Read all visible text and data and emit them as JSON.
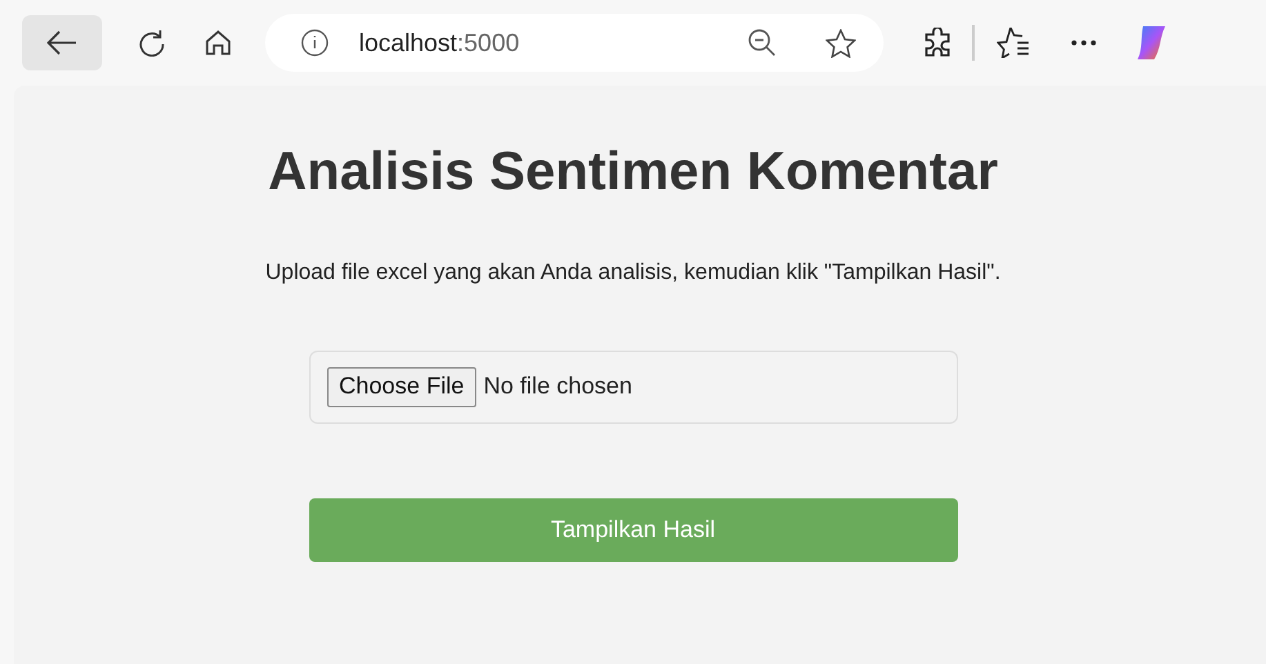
{
  "browser": {
    "address": {
      "host": "localhost",
      "port": ":5000"
    }
  },
  "page": {
    "title": "Analisis Sentimen Komentar",
    "instruction": "Upload file excel yang akan Anda analisis, kemudian klik \"Tampilkan Hasil\".",
    "file_input": {
      "button": "Choose File",
      "status": "No file chosen"
    },
    "submit": "Tampilkan Hasil"
  }
}
